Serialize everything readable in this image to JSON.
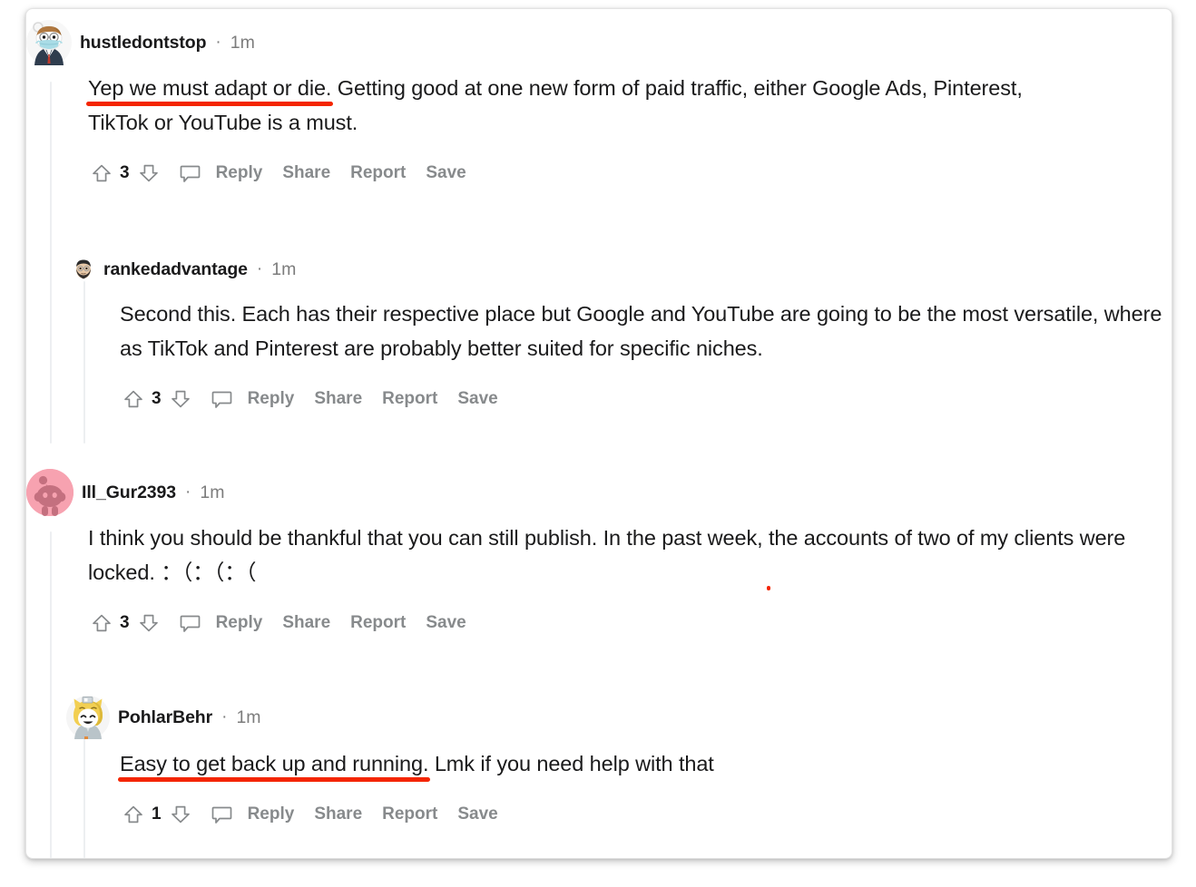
{
  "page": {
    "title": "Reddit comment thread",
    "accent_red": "#f42500",
    "text_color": "#1a1a1b",
    "meta_color": "#7c7c7c",
    "action_color": "#878a8c",
    "threadline_color": "#edeff1"
  },
  "actions_labels": {
    "reply": "Reply",
    "share": "Share",
    "report": "Report",
    "save": "Save",
    "upvote_icon": "upvote-arrow-icon",
    "downvote_icon": "downvote-arrow-icon",
    "comment_icon": "comment-bubble-icon"
  },
  "comments": [
    {
      "id": "c1",
      "username": "hustledontstop",
      "separator": "·",
      "age": "1m",
      "avatar": "snoo-suit-mask-avatar",
      "score": "3",
      "body_pre": "",
      "body_underlined": "Yep we must adapt or die.",
      "body_post": " Getting good at one new form of paid traffic, either Google Ads, Pinterest, TikTok or YouTube is a must."
    },
    {
      "id": "c2",
      "username": "rankedadvantage",
      "separator": "·",
      "age": "1m",
      "avatar": "memoji-bearded-face-avatar",
      "score": "3",
      "body_pre": "Second this. Each has their respective place but Google and YouTube are going to be the most versatile, where as TikTok and Pinterest are probably better suited for specific niches.",
      "body_underlined": "",
      "body_post": ""
    },
    {
      "id": "c3",
      "username": "Ill_Gur2393",
      "separator": "·",
      "age": "1m",
      "avatar": "pink-snoo-avatar",
      "score": "3",
      "body_pre": "I think you should be thankful that you can still publish. In the past week, ",
      "body_underlined": "the accounts of two of my clients were locked.",
      "body_post": " ：（：（：（"
    },
    {
      "id": "c4",
      "username": "PohlarBehr",
      "separator": "·",
      "age": "1m",
      "avatar": "snoo-cat-hood-avatar",
      "score": "1",
      "body_pre": "",
      "body_underlined": "Easy to get back up and running.",
      "body_post": " Lmk if you need help with that"
    }
  ]
}
